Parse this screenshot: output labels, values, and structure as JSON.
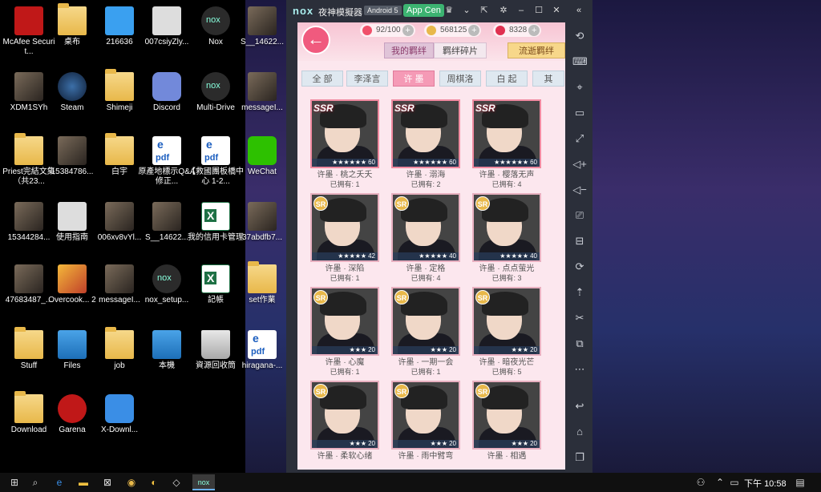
{
  "desktop": {
    "icons": [
      {
        "label": "McAfee Securit...",
        "kind": "mcafee"
      },
      {
        "label": "桌布",
        "kind": "folder"
      },
      {
        "label": "216636",
        "kind": "phone"
      },
      {
        "label": "007csiyZly...",
        "kind": "dark"
      },
      {
        "label": "Nox",
        "kind": "nox"
      },
      {
        "label": "S__14622...",
        "kind": "photo"
      },
      {
        "label": "XDM1SYh",
        "kind": "photo"
      },
      {
        "label": "Steam",
        "kind": "steam"
      },
      {
        "label": "Shimeji",
        "kind": "folder"
      },
      {
        "label": "Discord",
        "kind": "discord"
      },
      {
        "label": "Multi-Drive",
        "kind": "nox"
      },
      {
        "label": "messageI...",
        "kind": "photo"
      },
      {
        "label": "Priest完結文集（共23...",
        "kind": "folder"
      },
      {
        "label": "15384786...",
        "kind": "photo"
      },
      {
        "label": "白宇",
        "kind": "folder"
      },
      {
        "label": "原產地標示Q&A修正...",
        "kind": "pdf"
      },
      {
        "label": "【救國團板橋中心 1-2...",
        "kind": "pdf"
      },
      {
        "label": "WeChat",
        "kind": "wechat"
      },
      {
        "label": "15344284...",
        "kind": "photo"
      },
      {
        "label": "使用指南",
        "kind": "dark"
      },
      {
        "label": "006xv8vYl...",
        "kind": "photo"
      },
      {
        "label": "S__14622...",
        "kind": "photo"
      },
      {
        "label": "我的信用卡管理",
        "kind": "excel"
      },
      {
        "label": "37abdfb7...",
        "kind": "photo"
      },
      {
        "label": "47683487_...",
        "kind": "photo"
      },
      {
        "label": "Overcook... 2",
        "kind": "overcook"
      },
      {
        "label": "messageI...",
        "kind": "photo"
      },
      {
        "label": "nox_setup...",
        "kind": "nox"
      },
      {
        "label": "記帳",
        "kind": "excel"
      },
      {
        "label": "set作業",
        "kind": "folder"
      },
      {
        "label": "Stuff",
        "kind": "folder"
      },
      {
        "label": "Files",
        "kind": "pc"
      },
      {
        "label": "job",
        "kind": "folder"
      },
      {
        "label": "本機",
        "kind": "pc"
      },
      {
        "label": "資源回收筒",
        "kind": "bin"
      },
      {
        "label": "hiragana-...",
        "kind": "pdf"
      },
      {
        "label": "Download",
        "kind": "folder"
      },
      {
        "label": "Garena",
        "kind": "garena"
      },
      {
        "label": "X-Downl...",
        "kind": "app"
      }
    ]
  },
  "nox": {
    "logo": "nox",
    "title": "夜神模擬器 6",
    "android": "Android 5",
    "app_center": "App Cen",
    "title_buttons": [
      "gift-icon",
      "chevron-down-icon",
      "pin-icon",
      "settings-icon",
      "minimize-icon",
      "maximize-icon",
      "close-icon",
      "collapse-icon"
    ],
    "side_buttons": [
      "rotate-icon",
      "keyboard-icon",
      "location-icon",
      "screen-icon",
      "fullscreen-icon",
      "volume-up-icon",
      "volume-down-icon",
      "screenshot-icon",
      "install-icon",
      "shake-icon",
      "speed-icon",
      "scissors-icon",
      "multi-window-icon",
      "more-icon",
      "back-icon",
      "home-icon",
      "recent-icon"
    ]
  },
  "game": {
    "resources": [
      {
        "value": "92/100",
        "color": "#f0506a"
      },
      {
        "value": "568125",
        "color": "#e8b84a"
      },
      {
        "value": "8328",
        "color": "#e03050"
      }
    ],
    "subtabs": {
      "mine": "我的羁绊",
      "fragments": "羁绊碎片",
      "flow": "流逝羁绊"
    },
    "characters": [
      "全 部",
      "李泽言",
      "许 墨",
      "周棋洛",
      "白 起",
      "其"
    ],
    "active_character": 2,
    "cards": [
      {
        "rarity": "SSR",
        "stars": "★★★★★★",
        "level": "60",
        "name": "许墨 · 桃之夭夭",
        "owned": "已拥有: 1",
        "bg": "bg-a"
      },
      {
        "rarity": "SSR",
        "stars": "★★★★★★",
        "level": "60",
        "name": "许墨 · 溺海",
        "owned": "已拥有: 2",
        "bg": "bg-b"
      },
      {
        "rarity": "SSR",
        "stars": "★★★★★★",
        "level": "60",
        "name": "许墨 · 樱落无声",
        "owned": "已拥有: 4",
        "bg": "bg-c"
      },
      {
        "rarity": "SR",
        "stars": "★★★★★",
        "level": "42",
        "name": "许墨 · 深陷",
        "owned": "已拥有: 1",
        "bg": "bg-d"
      },
      {
        "rarity": "SR",
        "stars": "★★★★★",
        "level": "40",
        "name": "许墨 · 定格",
        "owned": "已拥有: 4",
        "bg": "bg-e"
      },
      {
        "rarity": "SR",
        "stars": "★★★★★",
        "level": "40",
        "name": "许墨 · 点点萤光",
        "owned": "已拥有: 3",
        "bg": "bg-f"
      },
      {
        "rarity": "SR",
        "stars": "★★★",
        "level": "20",
        "name": "许墨 · 心魔",
        "owned": "已拥有: 1",
        "bg": "bg-g"
      },
      {
        "rarity": "SR",
        "stars": "★★★",
        "level": "20",
        "name": "许墨 · 一期一会",
        "owned": "已拥有: 1",
        "bg": "bg-h"
      },
      {
        "rarity": "SR",
        "stars": "★★★",
        "level": "20",
        "name": "许墨 · 暗夜光芒",
        "owned": "已拥有: 5",
        "bg": "bg-i"
      },
      {
        "rarity": "SR",
        "stars": "★★★",
        "level": "20",
        "name": "许墨 · 柔软心绪",
        "owned": "",
        "bg": "bg-j"
      },
      {
        "rarity": "SR",
        "stars": "★★★",
        "level": "20",
        "name": "许墨 · 雨中臂弯",
        "owned": "",
        "bg": "bg-k"
      },
      {
        "rarity": "SR",
        "stars": "★★★",
        "level": "20",
        "name": "许墨 · 相遇",
        "owned": "",
        "bg": "bg-l"
      }
    ]
  },
  "taskbar": {
    "apps": [
      "start-icon",
      "search-icon",
      "edge-icon",
      "file-explorer-icon",
      "store-icon",
      "chrome-icon",
      "app-icon",
      "app-icon",
      "skype-icon",
      "nox-icon"
    ],
    "tray": [
      "people-icon",
      "chevron-up-icon",
      "network-icon",
      "volume-icon"
    ],
    "ime": "下午",
    "time": "10:58",
    "notification": "notification-icon"
  }
}
